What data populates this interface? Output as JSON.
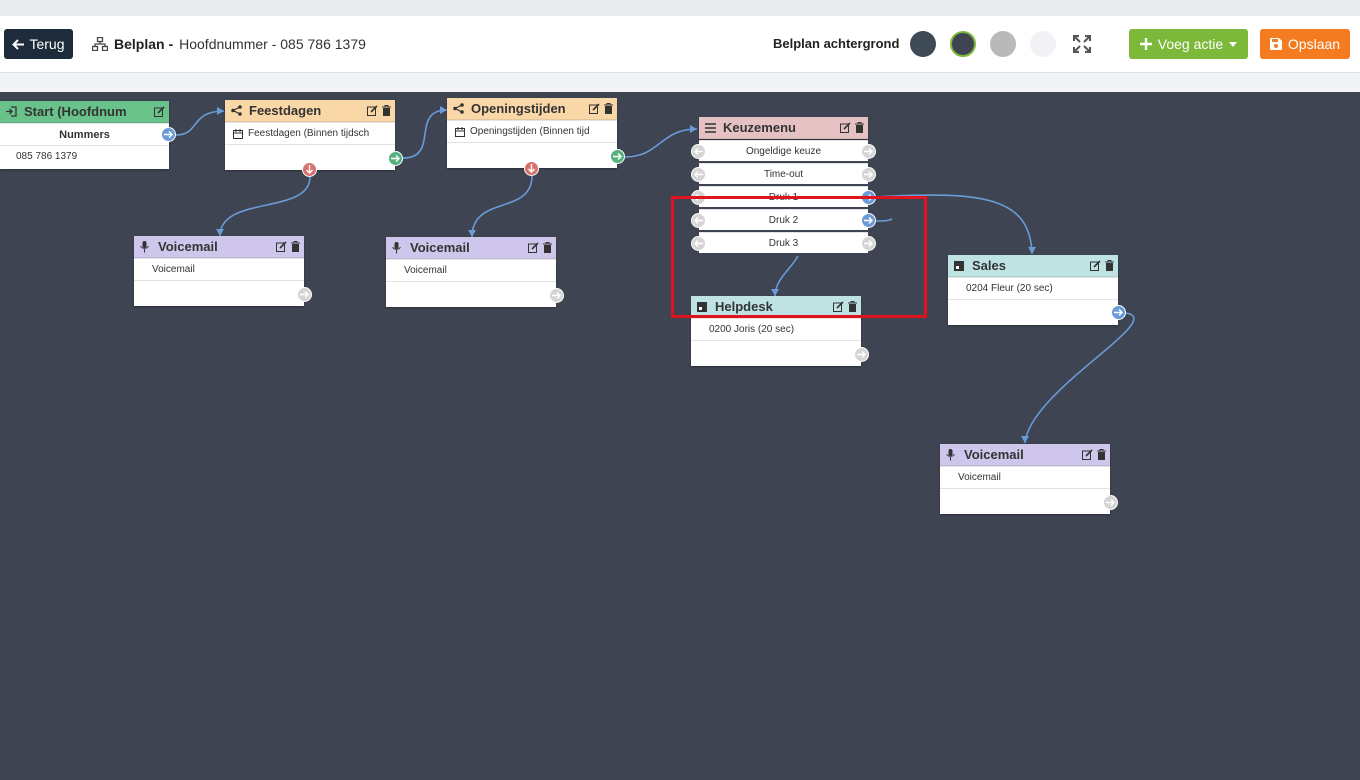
{
  "toolbar": {
    "back_label": "Terug",
    "title_prefix": "Belplan -",
    "title_rest": "Hoofdnummer - 085 786 1379",
    "background_label": "Belplan achtergrond",
    "add_action_label": "Voeg actie",
    "save_label": "Opslaan",
    "swatch_colors": [
      "#3e4a56",
      "#3e4451",
      "#b9b9b9",
      "#f1f2f6"
    ]
  },
  "nodes": {
    "start": {
      "title": "Start (Hoofdnum",
      "header_row": "Nummers",
      "number": "085 786 1379",
      "color": "#68c28a"
    },
    "feestdagen": {
      "title": "Feestdagen",
      "row": "Feestdagen (Binnen tijdsch",
      "color": "#f9d7a6"
    },
    "openingstijden": {
      "title": "Openingstijden",
      "row": "Openingstijden (Binnen tijd",
      "color": "#f9d7a6"
    },
    "voicemail1": {
      "title": "Voicemail",
      "row": "Voicemail",
      "color": "#cfc6ec"
    },
    "voicemail2": {
      "title": "Voicemail",
      "row": "Voicemail",
      "color": "#cfc6ec"
    },
    "keuzemenu": {
      "title": "Keuzemenu",
      "color": "#e6c1c3",
      "options": [
        "Ongeldige keuze",
        "Time-out",
        "Druk 1",
        "Druk 2",
        "Druk 3"
      ]
    },
    "helpdesk": {
      "title": "Helpdesk",
      "row": "0200 Joris (20 sec)",
      "color": "#bfe3e2"
    },
    "sales": {
      "title": "Sales",
      "row": "0204 Fleur (20 sec)",
      "color": "#bfe3e2"
    },
    "voicemail3": {
      "title": "Voicemail",
      "row": "Voicemail",
      "color": "#cfc6ec"
    }
  }
}
